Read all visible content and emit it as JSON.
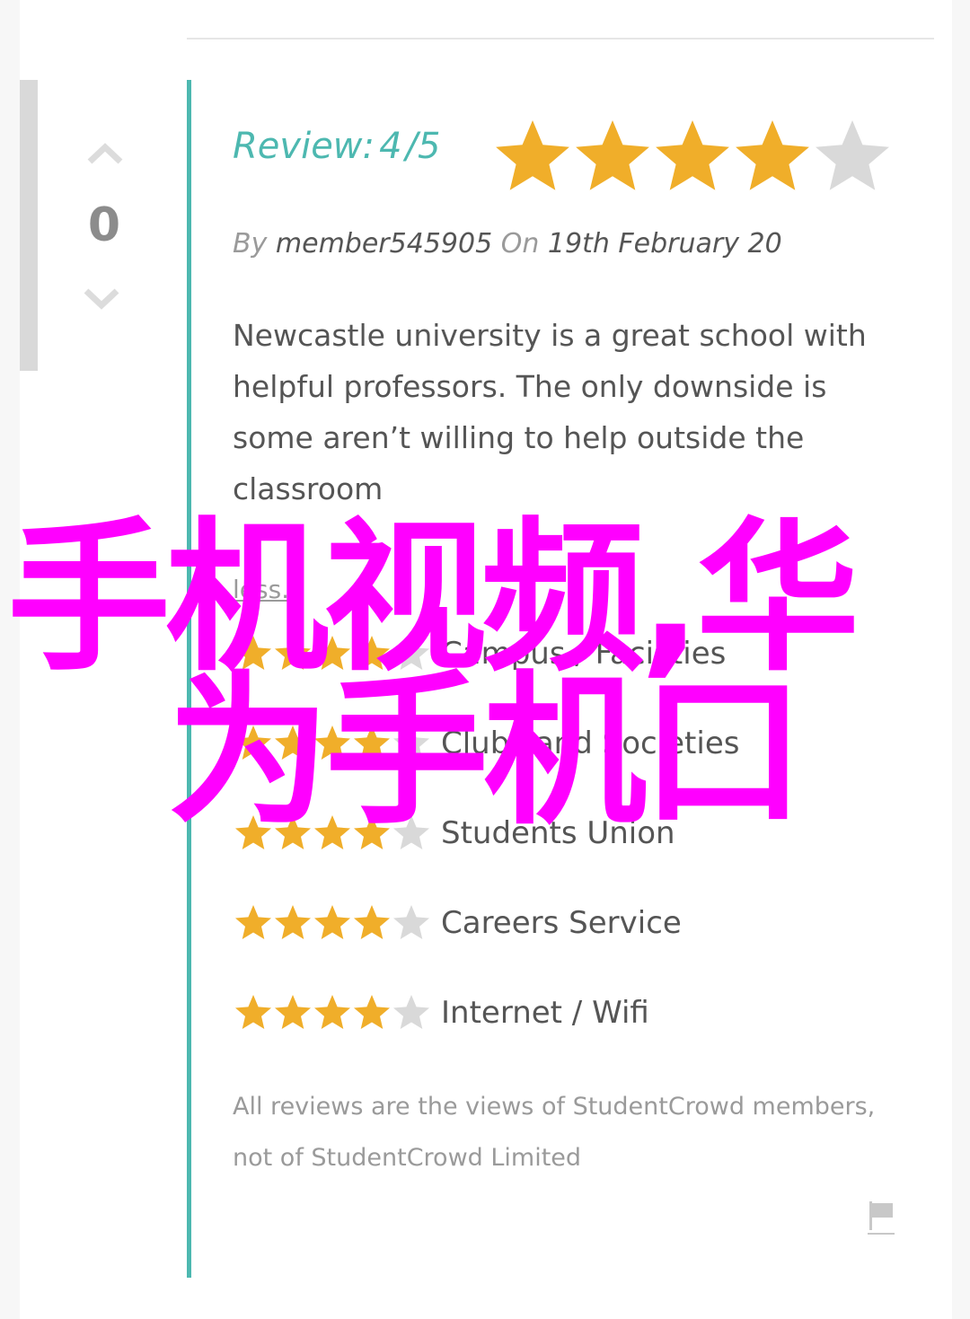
{
  "colors": {
    "accent": "#4db8b0",
    "star_filled": "#f0ae2a",
    "star_empty": "#d9d9d9",
    "overlay": "#ff00ff"
  },
  "vote": {
    "count": "0",
    "up_icon": "chevron-up-icon",
    "down_icon": "chevron-down-icon"
  },
  "review": {
    "label": "Review:",
    "score": "4",
    "separator": "/",
    "max": "5",
    "rating": 4,
    "by_label": "By",
    "author": "member545905",
    "on_label": "On",
    "date": "19th February 20",
    "body": "Newcastle university is a great school with helpful professors. The only downside is some aren’t willing to help outside the classroom",
    "less_label": "less."
  },
  "categories": [
    {
      "label": "Campus / Facilities",
      "rating": 4
    },
    {
      "label": "Clubs and Societies",
      "rating": 4
    },
    {
      "label": "Students Union",
      "rating": 4
    },
    {
      "label": "Careers Service",
      "rating": 4
    },
    {
      "label": "Internet / Wifi",
      "rating": 4
    }
  ],
  "disclaimer": "All reviews are the views of StudentCrowd members, not of StudentCrowd Limited",
  "flag_icon": "flag-icon",
  "overlay_text": {
    "line1": "手机视频,华",
    "line2": "为手机口"
  }
}
